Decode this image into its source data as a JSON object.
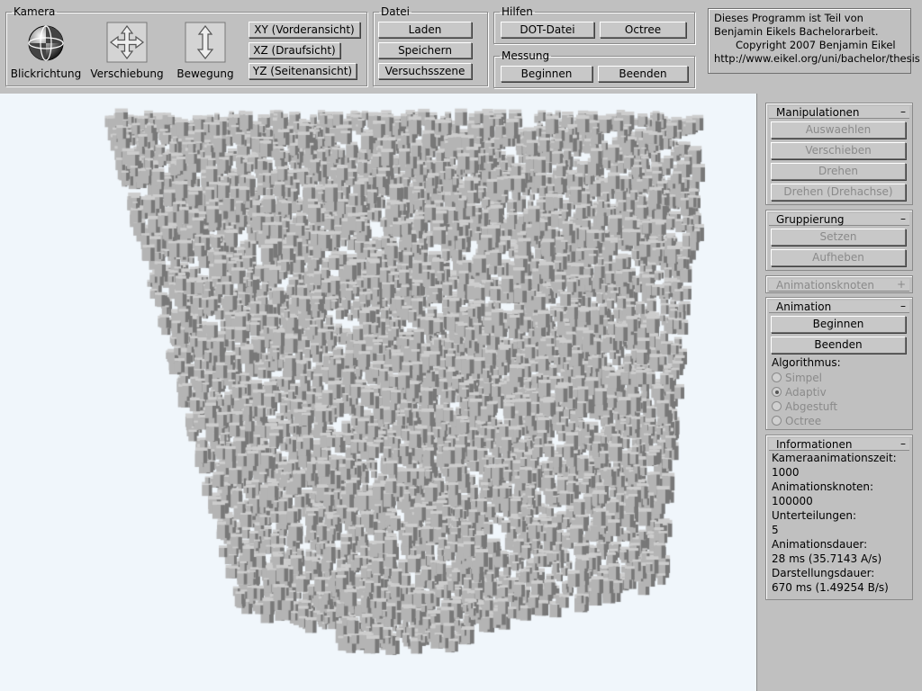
{
  "toolbar": {
    "kamera": {
      "legend": "Kamera",
      "tools": [
        {
          "label": "Blickrichtung",
          "icon": "view-direction-icon"
        },
        {
          "label": "Verschiebung",
          "icon": "move-arrows-icon"
        },
        {
          "label": "Bewegung",
          "icon": "movement-arrow-icon"
        }
      ],
      "views": [
        "XY (Vorderansicht)",
        "XZ (Draufsicht)",
        "YZ (Seitenansicht)"
      ]
    },
    "datei": {
      "legend": "Datei",
      "load": "Laden",
      "save": "Speichern",
      "scene": "Versuchsszene"
    },
    "hilfen": {
      "legend": "Hilfen",
      "dot": "DOT-Datei",
      "octree": "Octree"
    },
    "messung": {
      "legend": "Messung",
      "start": "Beginnen",
      "stop": "Beenden"
    },
    "info": {
      "line1": "Dieses Programm ist Teil von",
      "line2": "Benjamin Eikels Bachelorarbeit.",
      "line3": "Copyright 2007 Benjamin Eikel",
      "line4": "http://www.eikel.org/uni/bachelor/thesis"
    }
  },
  "sidebar": {
    "manipulationen": {
      "title": "Manipulationen",
      "toggle": "–",
      "buttons": [
        "Auswaehlen",
        "Verschieben",
        "Drehen",
        "Drehen (Drehachse)"
      ]
    },
    "gruppierung": {
      "title": "Gruppierung",
      "toggle": "–",
      "set": "Setzen",
      "unset": "Aufheben"
    },
    "animationsknoten": {
      "title": "Animationsknoten",
      "toggle": "+"
    },
    "animation": {
      "title": "Animation",
      "toggle": "–",
      "start": "Beginnen",
      "stop": "Beenden",
      "algo_label": "Algorithmus:",
      "options": [
        "Simpel",
        "Adaptiv",
        "Abgestuft",
        "Octree"
      ],
      "selected": "Adaptiv"
    },
    "informationen": {
      "title": "Informationen",
      "toggle": "–",
      "rows": [
        {
          "label": "Kameraanimationszeit:",
          "value": "1000"
        },
        {
          "label": "Animationsknoten:",
          "value": "100000"
        },
        {
          "label": "Unterteilungen:",
          "value": "5"
        },
        {
          "label": "Animationsdauer:",
          "value": "28 ms (35.7143 A/s)"
        },
        {
          "label": "Darstellungsdauer:",
          "value": "670 ms (1.49254 B/s)"
        }
      ]
    }
  },
  "colors": {
    "panel_bg": "#c0c0c0",
    "viewport_bg": "#f0f6fb",
    "cube_face": "#b4b4b4",
    "cube_top": "#cdcdcd",
    "cube_shadow": "#787878"
  }
}
